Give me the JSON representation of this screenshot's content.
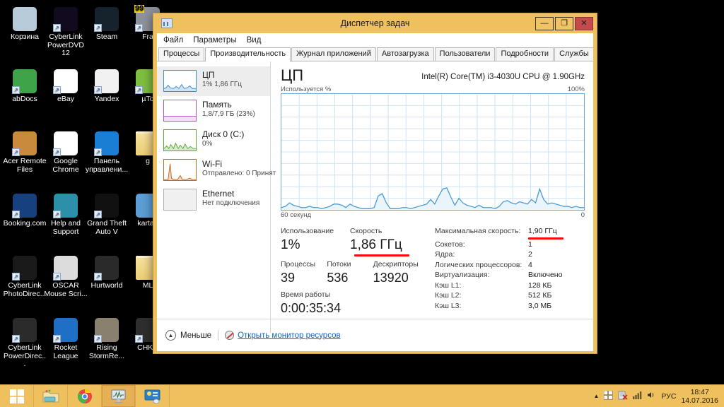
{
  "desktop": {
    "icons": [
      {
        "label": "Корзина",
        "name": "recycle-bin",
        "color": "#b8cbd8",
        "row": 0,
        "col": 0,
        "shortcut": false,
        "badge": null
      },
      {
        "label": "CyberLink PowerDVD 12",
        "name": "cyberlink-powerdvd-12",
        "color": "#120a1e",
        "row": 0,
        "col": 1,
        "shortcut": true,
        "badge": null
      },
      {
        "label": "Steam",
        "name": "steam",
        "color": "#16222c",
        "row": 0,
        "col": 2,
        "shortcut": true,
        "badge": null
      },
      {
        "label": "Fra",
        "name": "fraps",
        "color": "#8e9399",
        "row": 0,
        "col": 3,
        "shortcut": true,
        "badge": "99"
      },
      {
        "label": "abDocs",
        "name": "abdocs",
        "color": "#3fa34a",
        "row": 1,
        "col": 0,
        "shortcut": true,
        "badge": null
      },
      {
        "label": "eBay",
        "name": "ebay",
        "color": "#ffffff",
        "row": 1,
        "col": 1,
        "shortcut": true,
        "badge": null
      },
      {
        "label": "Yandex",
        "name": "yandex",
        "color": "#f1f1f1",
        "row": 1,
        "col": 2,
        "shortcut": true,
        "badge": null
      },
      {
        "label": "µTo",
        "name": "utorrent",
        "color": "#7fbf3f",
        "row": 1,
        "col": 3,
        "shortcut": true,
        "badge": null
      },
      {
        "label": "Acer Remote Files",
        "name": "acer-remote-files",
        "color": "#c98a3c",
        "row": 2,
        "col": 0,
        "shortcut": true,
        "badge": null
      },
      {
        "label": "Google Chrome",
        "name": "google-chrome",
        "color": "#ffffff",
        "row": 2,
        "col": 1,
        "shortcut": true,
        "badge": null
      },
      {
        "label": "Панель управлени...",
        "name": "intel-control-panel",
        "color": "#1a7fd4",
        "row": 2,
        "col": 2,
        "shortcut": true,
        "badge": null
      },
      {
        "label": "g",
        "name": "folder-g",
        "color": "#f5d888",
        "row": 2,
        "col": 3,
        "shortcut": false,
        "badge": null
      },
      {
        "label": "Booking.com",
        "name": "booking-com",
        "color": "#17407f",
        "row": 3,
        "col": 0,
        "shortcut": true,
        "badge": null
      },
      {
        "label": "Help and Support",
        "name": "help-and-support",
        "color": "#2d8fa8",
        "row": 3,
        "col": 1,
        "shortcut": true,
        "badge": null
      },
      {
        "label": "Grand Theft Auto V",
        "name": "grand-theft-auto-v",
        "color": "#111111",
        "row": 3,
        "col": 2,
        "shortcut": true,
        "badge": null
      },
      {
        "label": "karta_",
        "name": "karta-image",
        "color": "#5c9fd6",
        "row": 3,
        "col": 3,
        "shortcut": false,
        "badge": null
      },
      {
        "label": "CyberLink PhotoDirec...",
        "name": "cyberlink-photodirector",
        "color": "#1a1a1a",
        "row": 4,
        "col": 0,
        "shortcut": true,
        "badge": null
      },
      {
        "label": "OSCAR Mouse Scri...",
        "name": "oscar-mouse-script",
        "color": "#dcdcdc",
        "row": 4,
        "col": 1,
        "shortcut": true,
        "badge": null
      },
      {
        "label": "Hurtworld",
        "name": "hurtworld",
        "color": "#2a2a2a",
        "row": 4,
        "col": 2,
        "shortcut": true,
        "badge": null
      },
      {
        "label": "ML",
        "name": "folder-ml",
        "color": "#f5d888",
        "row": 4,
        "col": 3,
        "shortcut": false,
        "badge": null
      },
      {
        "label": "CyberLink PowerDirec...",
        "name": "cyberlink-powerdirector",
        "color": "#2b2b2b",
        "row": 5,
        "col": 0,
        "shortcut": true,
        "badge": null
      },
      {
        "label": "Rocket League",
        "name": "rocket-league",
        "color": "#1f6fc4",
        "row": 5,
        "col": 1,
        "shortcut": true,
        "badge": null
      },
      {
        "label": "Rising StormRe...",
        "name": "rising-storm",
        "color": "#8a8070",
        "row": 5,
        "col": 2,
        "shortcut": true,
        "badge": null
      },
      {
        "label": "CHKN",
        "name": "chkn",
        "color": "#2f2f2f",
        "row": 5,
        "col": 3,
        "shortcut": true,
        "badge": null
      }
    ]
  },
  "taskbar": {
    "buttons": [
      {
        "name": "start-button",
        "label": "Пуск",
        "active": false
      },
      {
        "name": "file-explorer-button",
        "label": "Проводник",
        "active": false
      },
      {
        "name": "chrome-button",
        "label": "Google Chrome",
        "active": false
      },
      {
        "name": "task-manager-button",
        "label": "Диспетчер задач",
        "active": true
      },
      {
        "name": "control-panel-button",
        "label": "Панель управления",
        "active": false
      }
    ],
    "tray": {
      "show_hidden_label": "▲",
      "language": "РУС",
      "time": "18:47",
      "date": "14.07.2016",
      "icons": [
        "windows-tray-icon",
        "security-tray-icon",
        "network-tray-icon",
        "volume-tray-icon"
      ]
    }
  },
  "window": {
    "title": "Диспетчер задач",
    "buttons": {
      "minimize": "—",
      "maximize": "❐",
      "close": "✕"
    },
    "menu": [
      "Файл",
      "Параметры",
      "Вид"
    ],
    "tabs": [
      {
        "label": "Процессы",
        "active": false
      },
      {
        "label": "Производительность",
        "active": true
      },
      {
        "label": "Журнал приложений",
        "active": false
      },
      {
        "label": "Автозагрузка",
        "active": false
      },
      {
        "label": "Пользователи",
        "active": false
      },
      {
        "label": "Подробности",
        "active": false
      },
      {
        "label": "Службы",
        "active": false
      }
    ]
  },
  "sidebar": {
    "items": [
      {
        "title": "ЦП",
        "sub": "1%  1,86 ГГц",
        "color": "#3b8fd4",
        "selected": true,
        "name": "sidebar-item-cpu"
      },
      {
        "title": "Память",
        "sub": "1,8/7,9 ГБ (23%)",
        "color": "#b martian",
        "selected": false,
        "name": "sidebar-item-memory"
      },
      {
        "title": "Диск 0 (C:)",
        "sub": "0%",
        "color": "#5aa832",
        "selected": false,
        "name": "sidebar-item-disk"
      },
      {
        "title": "Wi-Fi",
        "sub": "Отправлено: 0 Принят",
        "color": "#c4681f",
        "selected": false,
        "name": "sidebar-item-wifi"
      },
      {
        "title": "Ethernet",
        "sub": "Нет подключения",
        "color": "#9a9a9a",
        "selected": false,
        "name": "sidebar-item-ethernet"
      }
    ]
  },
  "main": {
    "heading": "ЦП",
    "model": "Intel(R) Core(TM) i3-4030U CPU @ 1.90GHz",
    "axis_top_left": "Используется %",
    "axis_top_right": "100%",
    "axis_bottom_left": "60 секунд",
    "axis_bottom_right": "0",
    "stats": {
      "utilization_label": "Использование",
      "utilization_value": "1%",
      "speed_label": "Скорость",
      "speed_value": "1,86 ГГц",
      "processes_label": "Процессы",
      "processes_value": "39",
      "threads_label": "Потоки",
      "threads_value": "536",
      "handles_label": "Дескрипторы",
      "handles_value": "13920",
      "uptime_label": "Время работы",
      "uptime_value": "0:00:35:34"
    },
    "details": [
      {
        "label": "Максимальная скорость:",
        "value": "1,90 ГГц"
      },
      {
        "label": "Сокетов:",
        "value": "1"
      },
      {
        "label": "Ядра:",
        "value": "2"
      },
      {
        "label": "Логических процессоров:",
        "value": "4"
      },
      {
        "label": "Виртуализация:",
        "value": "Включено"
      },
      {
        "label": "Кэш L1:",
        "value": "128 КБ"
      },
      {
        "label": "Кэш L2:",
        "value": "512 КБ"
      },
      {
        "label": "Кэш L3:",
        "value": "3,0 МБ"
      }
    ]
  },
  "footer": {
    "less_label": "Меньше",
    "resource_monitor_label": "Открыть монитор ресурсов"
  },
  "colors": {
    "accent_tan": "#efc05e",
    "cpu_blue": "#4a9bd4",
    "cpu_fill": "#e3f0fa",
    "close_red": "#c44b4b",
    "annotation_red": "#f60c0c",
    "link_blue": "#1b5fc1"
  },
  "chart_data": {
    "type": "area",
    "title": "Используется %",
    "xlabel": "60 секунд",
    "ylabel": "Используется %",
    "ylim": [
      0,
      100
    ],
    "xlim": [
      60,
      0
    ],
    "grid": true,
    "series": [
      {
        "name": "CPU utilization",
        "values": [
          2,
          3,
          6,
          4,
          3,
          2,
          2,
          3,
          2,
          2,
          1,
          2,
          3,
          5,
          5,
          4,
          2,
          5,
          3,
          2,
          1,
          1,
          1,
          2,
          12,
          14,
          6,
          1,
          1,
          1,
          2,
          2,
          1,
          2,
          3,
          4,
          5,
          9,
          5,
          12,
          18,
          19,
          11,
          4,
          10,
          6,
          4,
          3,
          2,
          4,
          2,
          2,
          2,
          1,
          3,
          7,
          8,
          6,
          5,
          7,
          6,
          5,
          9,
          6,
          18,
          9,
          5,
          6,
          5,
          4,
          3,
          3,
          2,
          3,
          2,
          2
        ]
      }
    ]
  }
}
